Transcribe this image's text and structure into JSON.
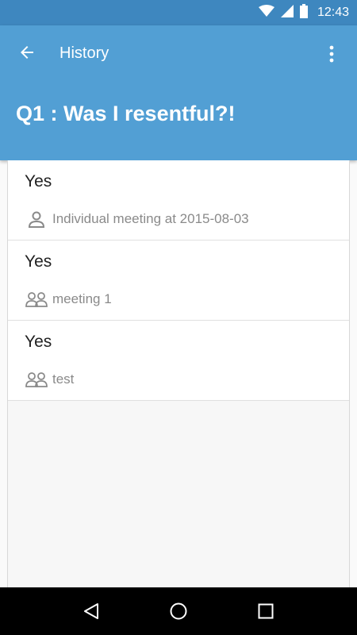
{
  "status_bar": {
    "time": "12:43"
  },
  "app_bar": {
    "title": "History",
    "question": "Q1 : Was I resentful?!"
  },
  "history": [
    {
      "answer": "Yes",
      "meta_icon": "person-icon",
      "meta_text": "Individual meeting at 2015-08-03"
    },
    {
      "answer": "Yes",
      "meta_icon": "group-icon",
      "meta_text": "meeting 1"
    },
    {
      "answer": "Yes",
      "meta_icon": "group-icon",
      "meta_text": "test"
    }
  ],
  "colors": {
    "status_bar": "#3e87bf",
    "app_bar": "#529fd4",
    "nav_bar": "#000000"
  }
}
